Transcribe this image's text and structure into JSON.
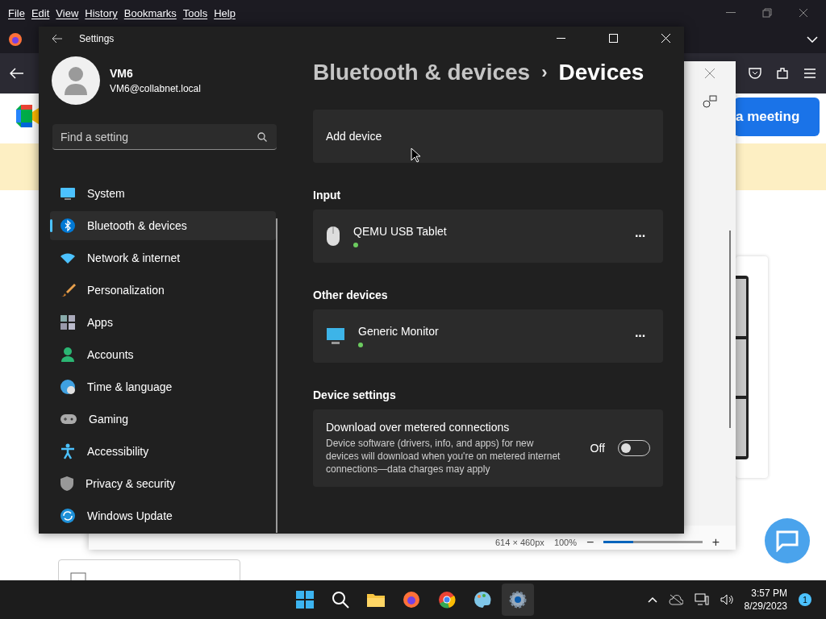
{
  "browser": {
    "menu": [
      "File",
      "Edit",
      "View",
      "History",
      "Bookmarks",
      "Tools",
      "Help"
    ],
    "page": {
      "button": "a meeting"
    }
  },
  "viewer": {
    "dimensions": "614 × 460px",
    "zoom": "100%",
    "minus": "−",
    "plus": "+",
    "level": 0.3
  },
  "settings": {
    "title": "Settings",
    "user": {
      "name": "VM6",
      "email": "VM6@collabnet.local"
    },
    "search": {
      "placeholder": "Find a setting"
    },
    "nav": [
      {
        "label": "System",
        "selected": false
      },
      {
        "label": "Bluetooth & devices",
        "selected": true
      },
      {
        "label": "Network & internet",
        "selected": false
      },
      {
        "label": "Personalization",
        "selected": false
      },
      {
        "label": "Apps",
        "selected": false
      },
      {
        "label": "Accounts",
        "selected": false
      },
      {
        "label": "Time & language",
        "selected": false
      },
      {
        "label": "Gaming",
        "selected": false
      },
      {
        "label": "Accessibility",
        "selected": false
      },
      {
        "label": "Privacy & security",
        "selected": false
      },
      {
        "label": "Windows Update",
        "selected": false
      }
    ],
    "breadcrumb": {
      "parent": "Bluetooth & devices",
      "separator": "›",
      "current": "Devices"
    },
    "add_device": "Add device",
    "sections": [
      {
        "heading": "Input",
        "devices": [
          {
            "name": "QEMU USB Tablet",
            "kind": "mouse",
            "more": "···"
          }
        ]
      },
      {
        "heading": "Other devices",
        "devices": [
          {
            "name": "Generic Monitor",
            "kind": "monitor",
            "more": "···"
          }
        ]
      }
    ],
    "device_settings": {
      "heading": "Device settings",
      "title": "Download over metered connections",
      "description": "Device software (drivers, info, and apps) for new devices will download when you're on metered internet connections—data charges may apply",
      "state_label": "Off",
      "on": false
    }
  },
  "taskbar": {
    "time": "3:57 PM",
    "date": "8/29/2023",
    "badge": "1"
  }
}
